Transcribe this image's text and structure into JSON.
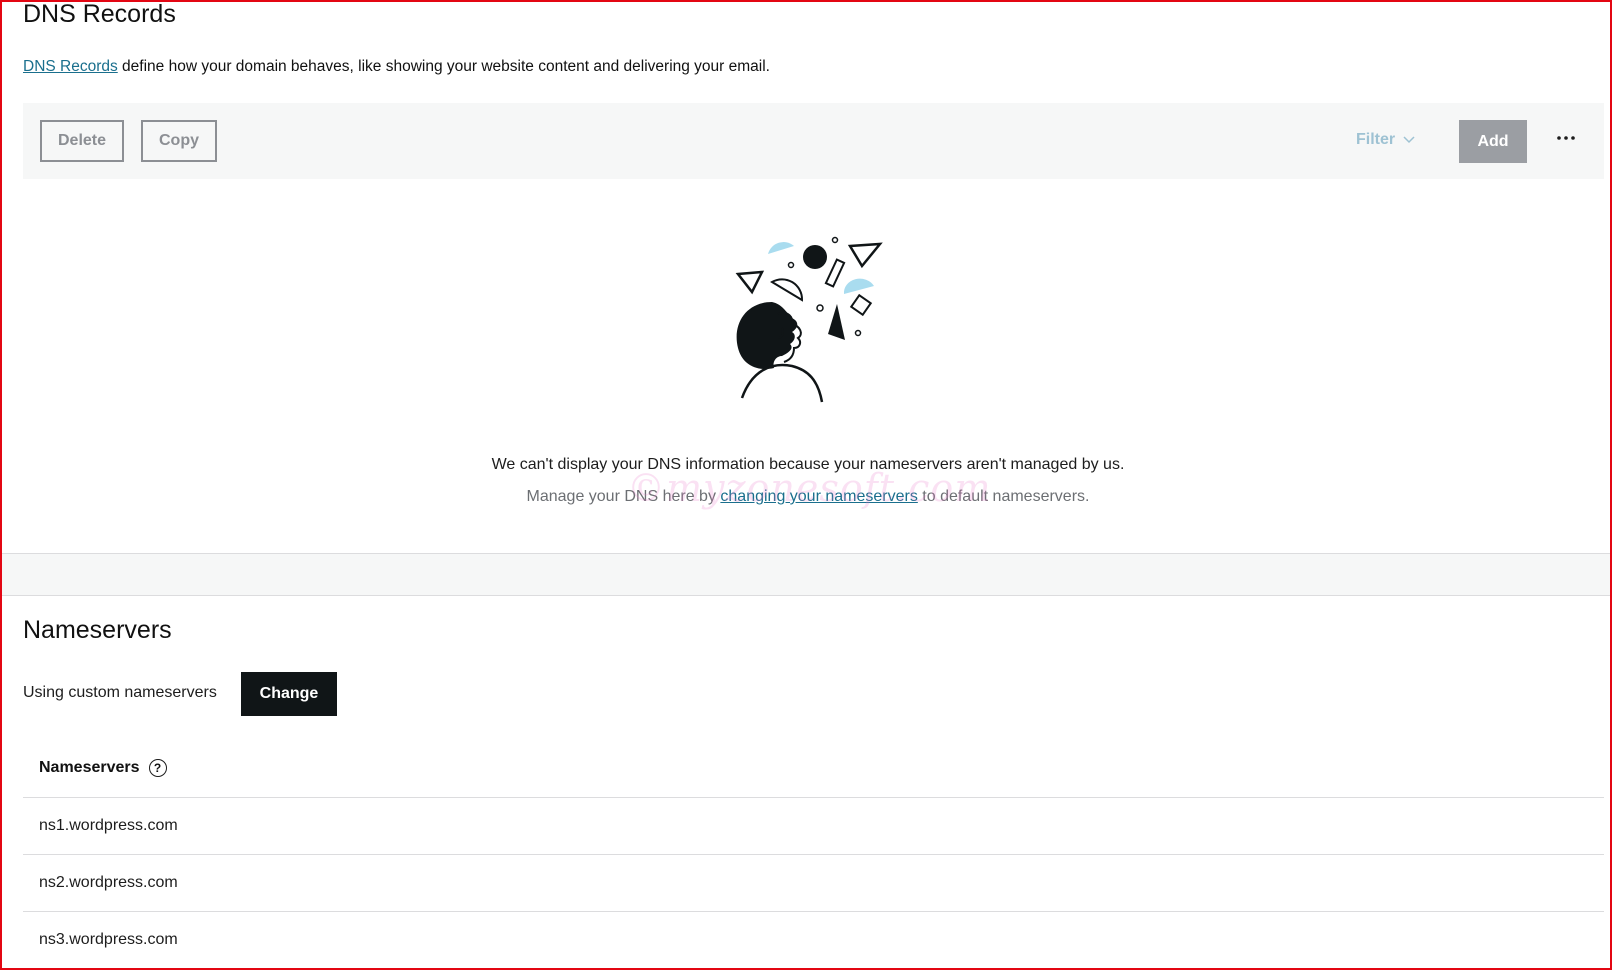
{
  "dns": {
    "title": "DNS Records",
    "intro_link": "DNS Records",
    "intro_text": " define how your domain behaves, like showing your website content and delivering your email.",
    "toolbar": {
      "delete_label": "Delete",
      "copy_label": "Copy",
      "filter_label": "Filter",
      "add_label": "Add"
    },
    "empty_message": "We can't display your DNS information because your nameservers aren't managed by us.",
    "manage_prefix": "Manage your DNS here by ",
    "manage_link": "changing your nameservers",
    "manage_suffix": " to default nameservers.",
    "watermark": "©myzonesoft.com"
  },
  "nameservers": {
    "title": "Nameservers",
    "status": "Using custom nameservers",
    "change_label": "Change",
    "column_header": "Nameservers",
    "rows": [
      "ns1.wordpress.com",
      "ns2.wordpress.com",
      "ns3.wordpress.com"
    ]
  },
  "colors": {
    "frame_border": "#e30613",
    "link": "#1a6f8d",
    "accent_light_blue": "#a9dcef",
    "disabled_gray": "#8c8f94",
    "change_button": "#101517"
  },
  "icons": [
    "filter-chevron-icon",
    "more-icon",
    "help-icon"
  ]
}
